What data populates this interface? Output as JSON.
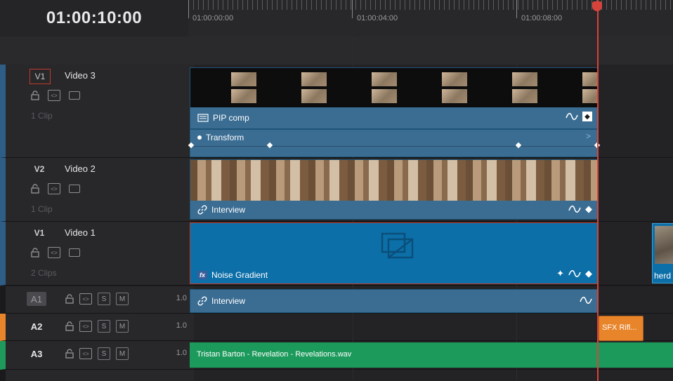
{
  "timecode": "01:00:10:00",
  "ruler": {
    "labels": [
      "01:00:00:00",
      "01:00:04:00",
      "01:00:08:00"
    ]
  },
  "tracks": {
    "v3": {
      "tag": "V1",
      "name": "Video 3",
      "clips": "1 Clip"
    },
    "v2": {
      "tag": "V2",
      "name": "Video 2",
      "clips": "1 Clip"
    },
    "v1": {
      "tag": "V1",
      "name": "Video 1",
      "clips": "2 Clips"
    },
    "a1": {
      "tag": "A1",
      "vol": "1.0"
    },
    "a2": {
      "tag": "A2",
      "vol": "1.0"
    },
    "a3": {
      "tag": "A3",
      "vol": "1.0"
    }
  },
  "audio_buttons": {
    "solo": "S",
    "mute": "M"
  },
  "clips": {
    "pip": "PIP comp",
    "transform": "Transform",
    "interview_video": "Interview",
    "noise": "Noise Gradient",
    "noise_badge": "fx",
    "herd": "herd",
    "interview_audio": "Interview",
    "sfx": "SFX Rifl...",
    "music": "Tristan Barton - Revelation - Revelations.wav"
  },
  "colors": {
    "video_clip": "#3b6d93",
    "generator_clip": "#0d6fa8",
    "sfx_clip": "#e8842a",
    "music_clip": "#1c9a5c",
    "playhead": "#d7433a"
  }
}
